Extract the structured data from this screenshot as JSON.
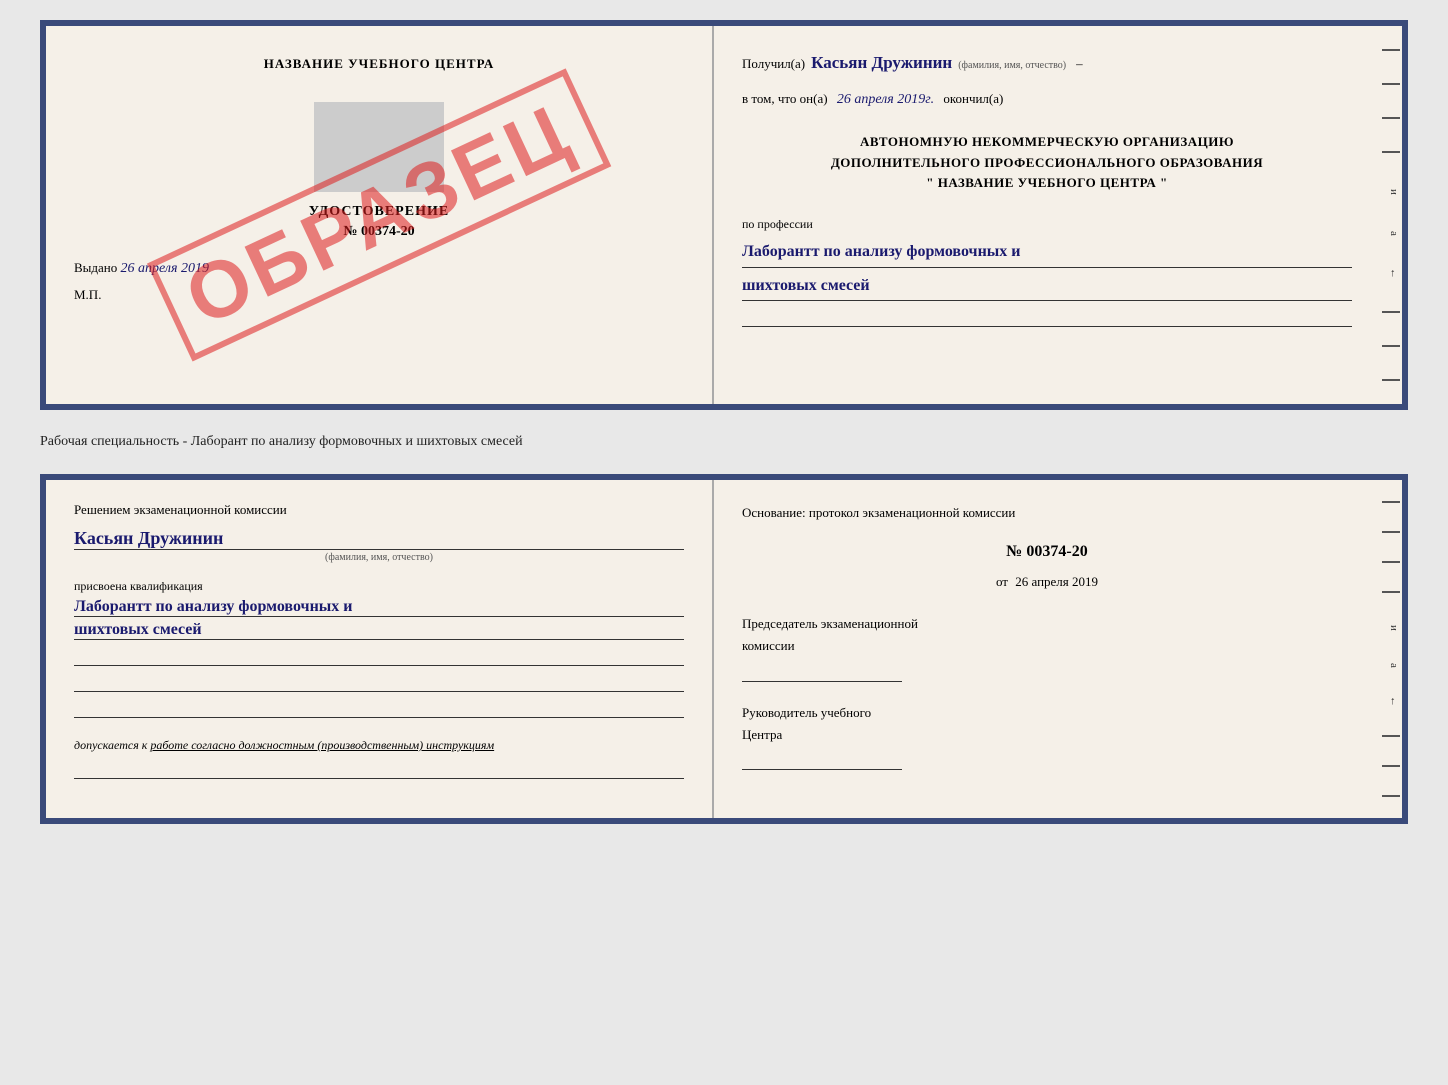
{
  "top_panel": {
    "left": {
      "title": "НАЗВАНИЕ УЧЕБНОГО ЦЕНТРА",
      "udost_label": "УДОСТОВЕРЕНИЕ",
      "number": "№ 00374-20",
      "vydano_label": "Выдано",
      "vydano_date": "26 апреля 2019",
      "mp_label": "М.П.",
      "stamp_text": "ОБРАЗЕЦ"
    },
    "right": {
      "poluchil_label": "Получил(а)",
      "recipient_name": "Касьян Дружинин",
      "fio_label": "(фамилия, имя, отчество)",
      "vtom_label": "в том, что он(а)",
      "vtom_date": "26 апреля 2019г.",
      "okonchil_label": "окончил(а)",
      "org_line1": "АВТОНОМНУЮ НЕКОММЕРЧЕСКУЮ ОРГАНИЗАЦИЮ",
      "org_line2": "ДОПОЛНИТЕЛЬНОГО ПРОФЕССИОНАЛЬНОГО ОБРАЗОВАНИЯ",
      "org_quote_open": "\"",
      "org_center_name": "НАЗВАНИЕ УЧЕБНОГО ЦЕНТРА",
      "org_quote_close": "\"",
      "po_professii_label": "по профессии",
      "profession_line1": "Лаборантт по анализу формовочных и",
      "profession_line2": "шихтовых смесей"
    }
  },
  "middle": {
    "text": "Рабочая специальность - Лаборант по анализу формовочных и шихтовых смесей"
  },
  "bottom_panel": {
    "left": {
      "resheniem_label": "Решением экзаменационной комиссии",
      "person_name": "Касьян Дружинин",
      "fio_label": "(фамилия, имя, отчество)",
      "prisvoena_label": "присвоена квалификация",
      "qualification_line1": "Лаборантт по анализу формовочных и",
      "qualification_line2": "шихтовых смесей",
      "dopuskaetsya_label": "допускается к",
      "dopuskaetsya_text": "работе согласно должностным (производственным) инструкциям"
    },
    "right": {
      "osnov_label": "Основание: протокол экзаменационной комиссии",
      "protocol_number": "№ 00374-20",
      "ot_label": "от",
      "protocol_date": "26 апреля 2019",
      "predsedatel_line1": "Председатель экзаменационной",
      "predsedatel_line2": "комиссии",
      "rukovoditel_line1": "Руководитель учебного",
      "rukovoditel_line2": "Центра"
    }
  }
}
